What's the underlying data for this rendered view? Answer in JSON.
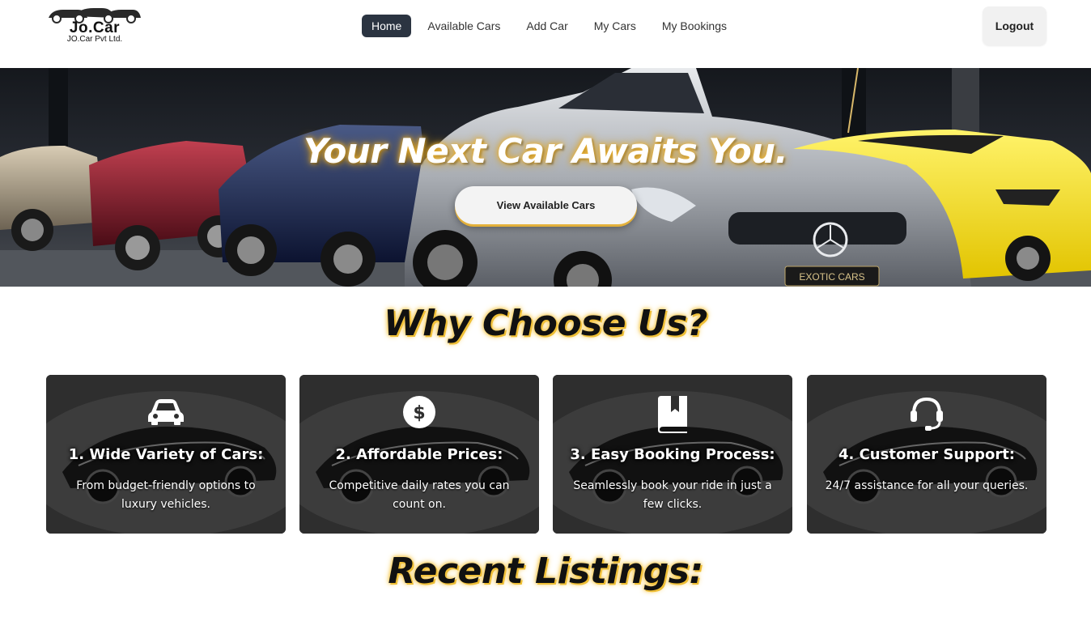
{
  "brand": {
    "name": "Jo.Car",
    "tagline": "JO.Car Pvt Ltd."
  },
  "nav": {
    "items": [
      {
        "label": "Home",
        "active": true
      },
      {
        "label": "Available Cars",
        "active": false
      },
      {
        "label": "Add Car",
        "active": false
      },
      {
        "label": "My Cars",
        "active": false
      },
      {
        "label": "My Bookings",
        "active": false
      }
    ],
    "logout_label": "Logout"
  },
  "hero": {
    "title": "Your Next Car Awaits You.",
    "cta_label": "View Available Cars",
    "plate_text": "EXOTIC CARS"
  },
  "why": {
    "title": "Why Choose Us?",
    "cards": [
      {
        "icon": "car-icon",
        "title": "1. Wide Variety of Cars:",
        "desc": "From budget-friendly options to luxury vehicles."
      },
      {
        "icon": "dollar-icon",
        "title": "2. Affordable Prices:",
        "desc": "Competitive daily rates you can count on."
      },
      {
        "icon": "book-icon",
        "title": "3. Easy Booking Process:",
        "desc": "Seamlessly book your ride in just a few clicks."
      },
      {
        "icon": "headset-icon",
        "title": "4. Customer Support:",
        "desc": "24/7 assistance for all your queries."
      }
    ]
  },
  "recent": {
    "title": "Recent Listings:"
  },
  "colors": {
    "nav_active": "#2b3441",
    "glow": "#f5c542",
    "card_bg": "#2a2a2a"
  }
}
